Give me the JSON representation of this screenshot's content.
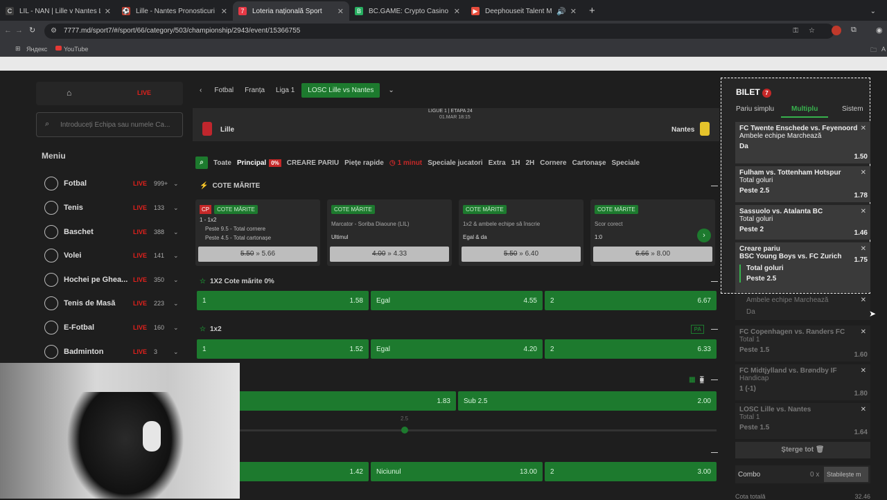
{
  "browser": {
    "tabs": [
      {
        "label": "LIL - NAN | Lille v Nantes LIVE",
        "icon": "C",
        "color": "#3c3c3c"
      },
      {
        "label": "Lille - Nantes Pronosticuri fotb",
        "icon": "⚽",
        "color": "#c0392b"
      },
      {
        "label": "Loteria națională Sport",
        "icon": "7",
        "color": "#e63946"
      },
      {
        "label": "BC.GAME: Crypto Casino Game",
        "icon": "B",
        "color": "#27ae60"
      },
      {
        "label": "Deephouseit Talent Mix - cl",
        "icon": "▶",
        "color": "#e74c3c"
      }
    ],
    "url": "7777.md/sport7/#/sport/66/category/503/championship/2943/event/15366755",
    "bookmarks": [
      "Яндекс",
      "YouTube"
    ],
    "all_bookmarks": "A"
  },
  "sidebar": {
    "live_label": "LIVE",
    "search_placeholder": "Introduceți Echipa sau numele Ca...",
    "menu_title": "Meniu",
    "items": [
      {
        "label": "Fotbal",
        "live": "LIVE",
        "count": "999+"
      },
      {
        "label": "Tenis",
        "live": "LIVE",
        "count": "133"
      },
      {
        "label": "Baschet",
        "live": "LIVE",
        "count": "388"
      },
      {
        "label": "Volei",
        "live": "LIVE",
        "count": "141"
      },
      {
        "label": "Hochei pe Ghea...",
        "live": "LIVE",
        "count": "350"
      },
      {
        "label": "Tenis de Masă",
        "live": "LIVE",
        "count": "223"
      },
      {
        "label": "E-Fotbal",
        "live": "LIVE",
        "count": "160"
      },
      {
        "label": "Badminton",
        "live": "LIVE",
        "count": "3"
      }
    ]
  },
  "breadcrumb": {
    "items": [
      "Fotbal",
      "Franța",
      "Liga 1"
    ],
    "active": "LOSC Lille vs Nantes"
  },
  "match": {
    "league": "LIGUE 1 | ETAPA 24",
    "date": "01.MAR 18:15",
    "home": "Lille",
    "away": "Nantes"
  },
  "filters": {
    "items": [
      "Toate",
      "Principal",
      "CREARE PARIU",
      "Piețe rapide",
      "1 minut",
      "Speciale jucatori",
      "Extra",
      "1H",
      "2H",
      "Cornere",
      "Cartonașe",
      "Speciale"
    ],
    "badge": "0%"
  },
  "cote": {
    "title": "COTE MĂRITE",
    "cards": [
      {
        "tag": "COTE MĂRITE",
        "cp": "CP",
        "line1": "1 - 1x2",
        "line2": "Peste 9.5 - Total cornere",
        "line3": "Peste 4.5 - Total cartonașe",
        "old": "5.50",
        "new": "5.66"
      },
      {
        "tag": "COTE MĂRITE",
        "line1": "Marcator - Soriba Diaoune (LIL)",
        "line2": "Ultimul",
        "old": "4.00",
        "new": "4.33"
      },
      {
        "tag": "COTE MĂRITE",
        "line1": "1x2 & ambele echipe să înscrie",
        "line2": "Egal & da",
        "old": "5.50",
        "new": "6.40"
      },
      {
        "tag": "COTE MĂRITE",
        "line1": "Scor corect",
        "line2": "1:0",
        "old": "6.66",
        "new": "8.00"
      }
    ],
    "arrow": "»"
  },
  "markets": {
    "m1": {
      "title": "1X2 Cote mărite 0%",
      "odds": [
        [
          "1",
          "1.58"
        ],
        [
          "Egal",
          "4.55"
        ],
        [
          "2",
          "6.67"
        ]
      ]
    },
    "m2": {
      "title": "1x2",
      "pa": "PA",
      "odds": [
        [
          "1",
          "1.52"
        ],
        [
          "Egal",
          "4.20"
        ],
        [
          "2",
          "6.33"
        ]
      ]
    },
    "m3": {
      "title": "ri",
      "odds": [
        [
          "",
          "1.83"
        ],
        [
          "Sub 2.5",
          "2.00"
        ]
      ],
      "slider": "2.5"
    },
    "m4": {
      "title": "l",
      "odds": [
        [
          "",
          "1.42"
        ],
        [
          "Niciunul",
          "13.00"
        ],
        [
          "2",
          "3.00"
        ]
      ]
    }
  },
  "slip": {
    "title": "BILET",
    "count": "7",
    "tabs": [
      "Pariu simplu",
      "Multiplu",
      "Sistem"
    ],
    "items": [
      {
        "match": "FC Twente Enschede vs. Feyenoord",
        "market": "Ambele echipe Marchează",
        "sel": "Da",
        "odd": "1.50"
      },
      {
        "match": "Fulham vs. Tottenham Hotspur",
        "market": "Total goluri",
        "sel": "Peste 2.5",
        "odd": "1.78"
      },
      {
        "match": "Sassuolo vs. Atalanta BC",
        "market": "Total goluri",
        "sel": "Peste 2",
        "odd": "1.46"
      }
    ],
    "creare": {
      "title": "Creare pariu",
      "match": "BSC Young Boys vs. FC Zurich",
      "odd": "1.75",
      "s1m": "Total goluri",
      "s1": "Peste 2.5",
      "s2m": "Ambele echipe Marchează",
      "s2": "Da"
    },
    "dim_items": [
      {
        "match": "FC Copenhagen vs. Randers FC",
        "market": "Total 1",
        "sel": "Peste 1.5",
        "odd": "1.60"
      },
      {
        "match": "FC Midtjylland vs. Brøndby IF",
        "market": "Handicap",
        "sel": "1 (-1)",
        "odd": "1.80"
      },
      {
        "match": "LOSC Lille vs. Nantes",
        "market": "Total 1",
        "sel": "Peste 1.5",
        "odd": "1.64"
      }
    ],
    "clear": "Șterge tot",
    "combo": "Combo",
    "combo_x": "0 x",
    "stake_placeholder": "Stabilește m",
    "total_label": "Cota totală",
    "total": "32.46"
  }
}
